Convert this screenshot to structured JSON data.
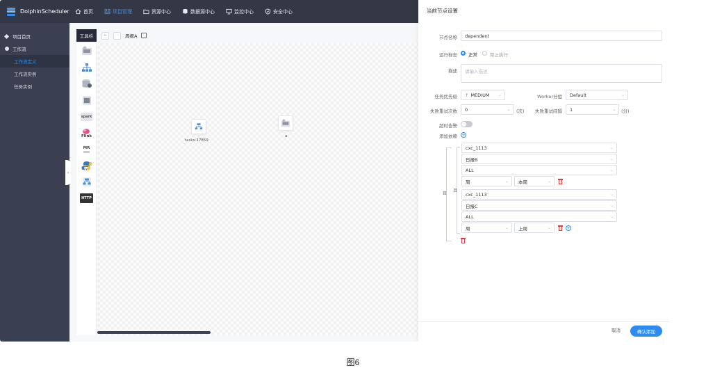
{
  "app": {
    "title": "DolphinScheduler",
    "brand_color": "#2d8cf0"
  },
  "nav": {
    "items": [
      {
        "label": "首页",
        "icon": "home-icon",
        "active": false
      },
      {
        "label": "项目管理",
        "icon": "project-icon",
        "active": true
      },
      {
        "label": "资源中心",
        "icon": "folder-icon",
        "active": false
      },
      {
        "label": "数据源中心",
        "icon": "database-icon",
        "active": false
      },
      {
        "label": "监控中心",
        "icon": "monitor-icon",
        "active": false
      },
      {
        "label": "安全中心",
        "icon": "shield-icon",
        "active": false
      }
    ]
  },
  "sidebar": {
    "items": [
      {
        "label": "项目首页",
        "icon": "home-icon"
      },
      {
        "label": "工作流",
        "icon": "workflow-icon"
      }
    ],
    "sub_items": [
      {
        "label": "工作流定义",
        "active": true
      },
      {
        "label": "工作流实例",
        "active": false
      },
      {
        "label": "任务实例",
        "active": false
      }
    ]
  },
  "toolbox": {
    "label": "工具栏",
    "tools": [
      {
        "icon": "shell-task-icon"
      },
      {
        "icon": "sub-process-task-icon"
      },
      {
        "icon": "procedure-task-icon"
      },
      {
        "icon": "sql-task-icon"
      },
      {
        "icon": "spark-task-icon",
        "text": "spark"
      },
      {
        "icon": "flink-task-icon",
        "text": "Flink"
      },
      {
        "icon": "mr-task-icon",
        "text": "MR"
      },
      {
        "icon": "python-task-icon",
        "text": "py"
      },
      {
        "icon": "dependent-task-icon"
      },
      {
        "icon": "http-task-icon",
        "text": "HTTP"
      }
    ]
  },
  "canvas": {
    "workflow_name": "周报A",
    "nodes": [
      {
        "label": "tasks-17859",
        "icon": "dependent-task-icon"
      },
      {
        "label": "a",
        "icon": "shell-task-icon"
      }
    ]
  },
  "panel": {
    "title": "当前节点设置",
    "node_name_label": "节点名称",
    "node_name_value": "dependent",
    "run_flag_label": "运行标志",
    "run_flag_options": [
      "正常",
      "禁止执行"
    ],
    "run_flag_selected": "正常",
    "description_label": "描述",
    "description_placeholder": "请输入描述",
    "priority_label": "任务优先级",
    "priority_value": "MEDIUM",
    "worker_group_label": "Worker分组",
    "worker_group_value": "Default",
    "retry_times_label": "失败重试次数",
    "retry_times_value": "0",
    "retry_times_unit": "(次)",
    "retry_interval_label": "失败重试间隔",
    "retry_interval_value": "1",
    "retry_interval_unit": "(分)",
    "timeout_label": "超时告警",
    "timeout_enabled": false,
    "dependency_label": "添加依赖",
    "outer_relation": "且",
    "groups": [
      {
        "relation": "且",
        "project": "cxc_1113",
        "workflow": "日报B",
        "task": "ALL",
        "cycle": "周",
        "date": "本周"
      },
      {
        "relation": "且",
        "project": "cxc_1113",
        "workflow": "日报C",
        "task": "ALL",
        "cycle": "周",
        "date": "上周"
      }
    ],
    "cancel_label": "取消",
    "confirm_label": "确认添加"
  },
  "caption": "图6"
}
